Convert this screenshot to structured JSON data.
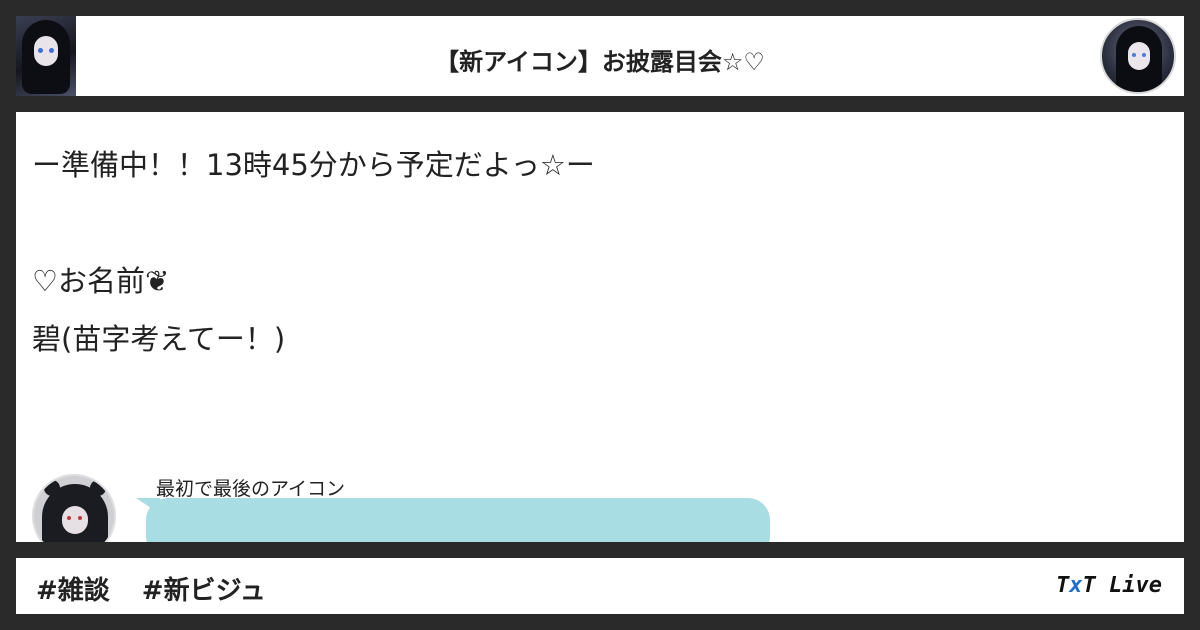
{
  "header": {
    "title": "【新アイコン】お披露目会☆♡"
  },
  "post": {
    "lines": [
      "ー準備中！！13時45分から予定だよっ☆ー",
      "♡お名前❦",
      "碧(苗字考えてー！)"
    ]
  },
  "reply": {
    "author": "最初で最後のアイコン"
  },
  "footer": {
    "hashtags": [
      "#雑談",
      "#新ビジュ"
    ],
    "brand": {
      "part1": "T",
      "part2": "x",
      "part3": "T Live"
    }
  },
  "colors": {
    "background": "#2a2a2a",
    "panel": "#ffffff",
    "reply_bubble": "#a7dde3",
    "brand_accent": "#1f6fd1"
  },
  "icons": {
    "header_thumb": "character-thumbnail",
    "header_avatar": "character-avatar",
    "reply_avatar": "hooded-character-avatar"
  }
}
